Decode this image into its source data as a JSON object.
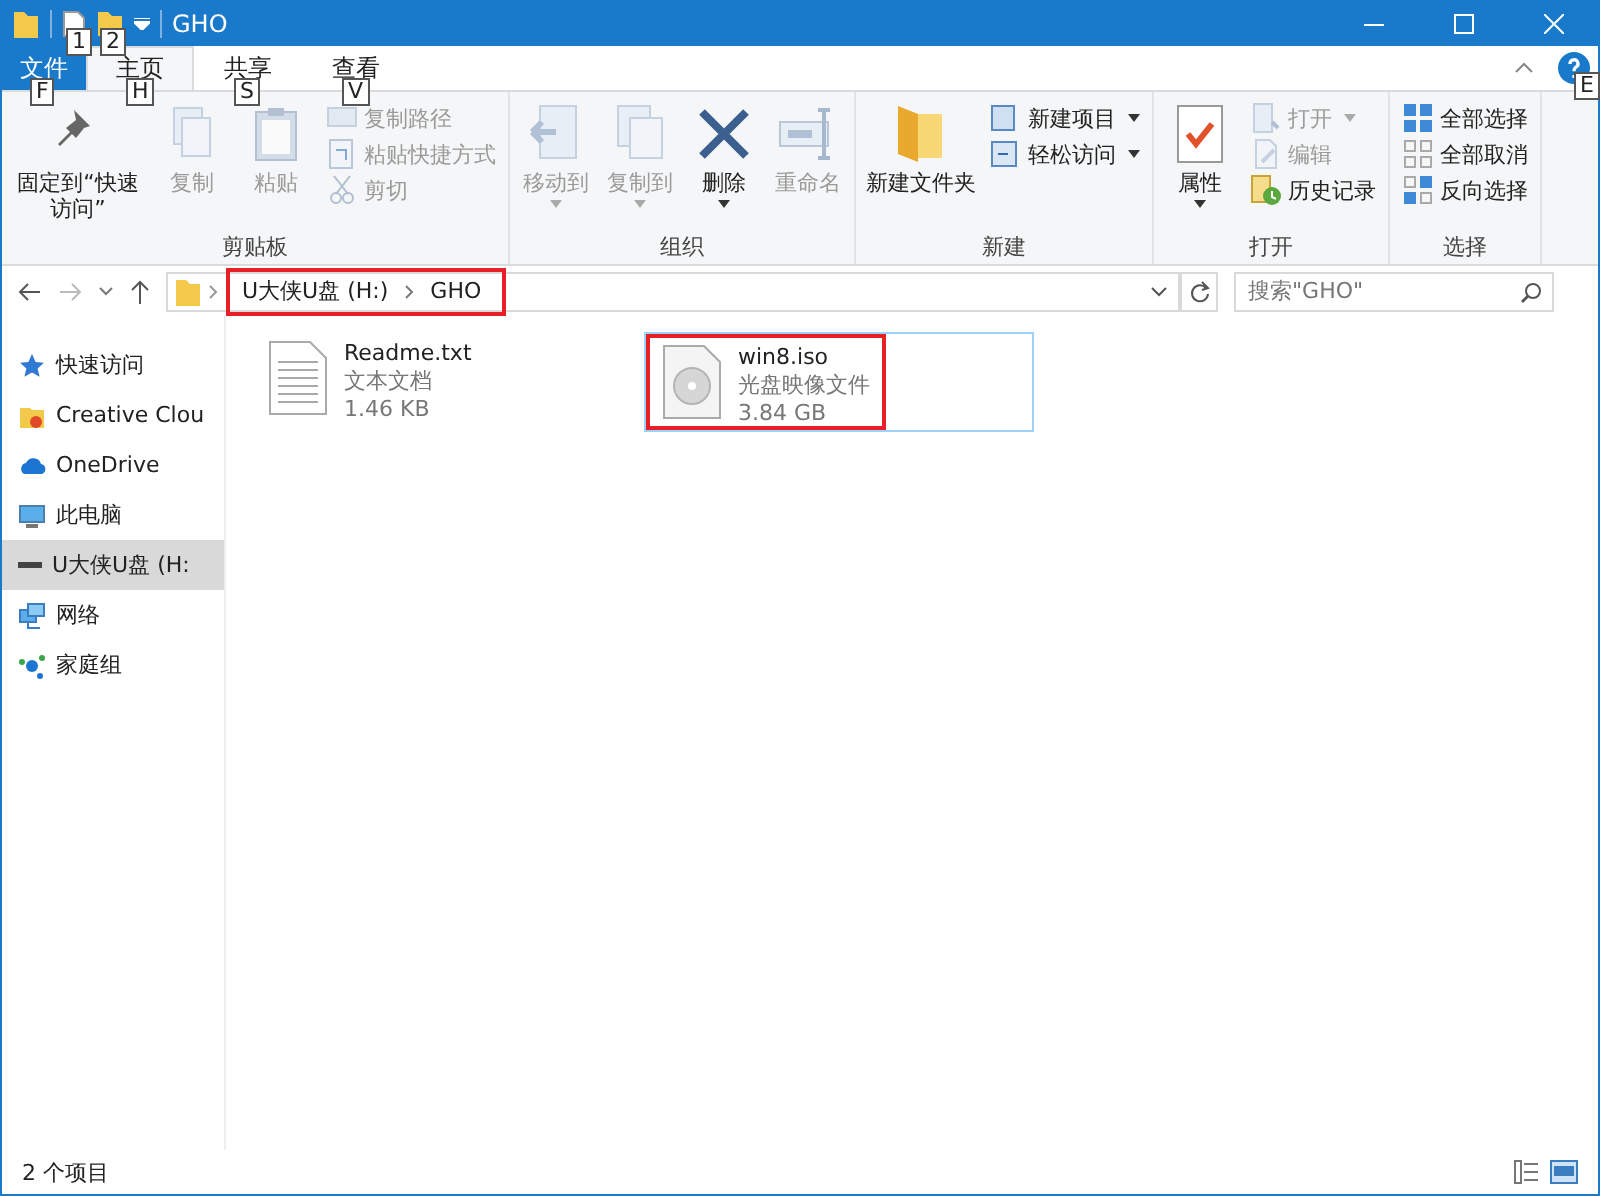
{
  "window": {
    "title": "GHO",
    "quick_access_tips": [
      "1",
      "2"
    ]
  },
  "tabs": [
    {
      "label": "文件",
      "kind": "file",
      "key_tip": "F",
      "selected": false
    },
    {
      "label": "主页",
      "kind": "normal",
      "key_tip": "H",
      "selected": true
    },
    {
      "label": "共享",
      "kind": "normal",
      "key_tip": "S",
      "selected": false
    },
    {
      "label": "查看",
      "kind": "normal",
      "key_tip": "V",
      "selected": false
    }
  ],
  "help": {
    "key_tip": "E"
  },
  "ribbon": [
    {
      "label": "剪贴板",
      "items": [
        {
          "label": "固定到“快速访问”",
          "kind": "large",
          "disabled": false,
          "dropdown": false
        },
        {
          "label": "复制",
          "kind": "large",
          "disabled": true,
          "dropdown": false
        },
        {
          "label": "粘贴",
          "kind": "large",
          "disabled": true,
          "dropdown": false
        },
        {
          "label": "复制路径",
          "kind": "small",
          "disabled": true,
          "dropdown": false
        },
        {
          "label": "粘贴快捷方式",
          "kind": "small",
          "disabled": true,
          "dropdown": false
        },
        {
          "label": "剪切",
          "kind": "small",
          "disabled": true,
          "dropdown": false
        }
      ]
    },
    {
      "label": "组织",
      "items": [
        {
          "label": "移动到",
          "kind": "large",
          "disabled": true,
          "dropdown": true
        },
        {
          "label": "复制到",
          "kind": "large",
          "disabled": true,
          "dropdown": true
        },
        {
          "label": "删除",
          "kind": "large",
          "disabled": false,
          "dropdown": true
        },
        {
          "label": "重命名",
          "kind": "large",
          "disabled": true,
          "dropdown": false
        }
      ]
    },
    {
      "label": "新建",
      "items": [
        {
          "label": "新建文件夹",
          "kind": "large",
          "disabled": false,
          "dropdown": false
        },
        {
          "label": "新建项目",
          "kind": "small",
          "disabled": false,
          "dropdown": true
        },
        {
          "label": "轻松访问",
          "kind": "small",
          "disabled": false,
          "dropdown": true
        }
      ]
    },
    {
      "label": "打开",
      "items": [
        {
          "label": "属性",
          "kind": "large",
          "disabled": false,
          "dropdown": true
        },
        {
          "label": "打开",
          "kind": "small",
          "disabled": true,
          "dropdown": true
        },
        {
          "label": "编辑",
          "kind": "small",
          "disabled": true,
          "dropdown": false
        },
        {
          "label": "历史记录",
          "kind": "small",
          "disabled": false,
          "dropdown": false
        }
      ]
    },
    {
      "label": "选择",
      "items": [
        {
          "label": "全部选择",
          "kind": "small",
          "disabled": false,
          "dropdown": false
        },
        {
          "label": "全部取消",
          "kind": "small",
          "disabled": false,
          "dropdown": false
        },
        {
          "label": "反向选择",
          "kind": "small",
          "disabled": false,
          "dropdown": false
        }
      ]
    }
  ],
  "address": {
    "segments": [
      "U大侠U盘 (H:)",
      "GHO"
    ],
    "highlighted": true
  },
  "search": {
    "placeholder": "搜索\"GHO\""
  },
  "sidebar": {
    "items": [
      {
        "label": "快速访问",
        "selected": false
      },
      {
        "label": "Creative Clou",
        "selected": false
      },
      {
        "label": "OneDrive",
        "selected": false
      },
      {
        "label": "此电脑",
        "selected": false
      },
      {
        "label": "U大侠U盘 (H:",
        "selected": true
      },
      {
        "label": "网络",
        "selected": false
      },
      {
        "label": "家庭组",
        "selected": false
      }
    ]
  },
  "files": [
    {
      "name": "Readme.txt",
      "type": "文本文档",
      "size": "1.46 KB",
      "kind": "text",
      "selected": false,
      "highlighted": false
    },
    {
      "name": "win8.iso",
      "type": "光盘映像文件",
      "size": "3.84 GB",
      "kind": "disc",
      "selected": true,
      "highlighted": true
    }
  ],
  "status_bar": {
    "count": "2 个项目"
  }
}
